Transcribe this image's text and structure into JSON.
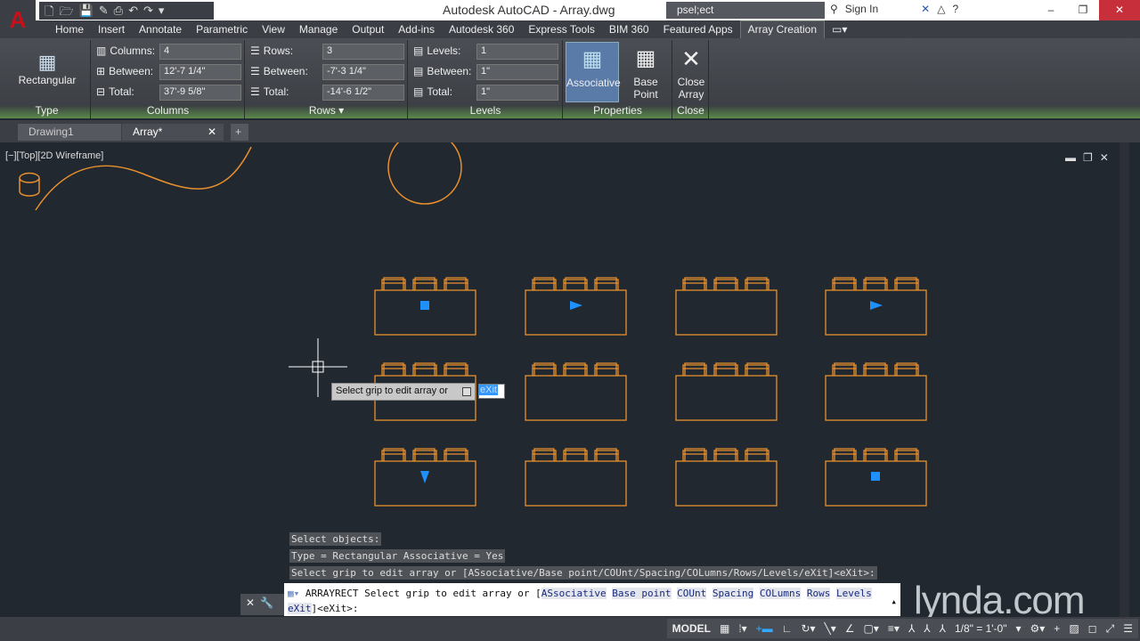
{
  "title": "Autodesk AutoCAD - Array.dwg",
  "search": "psel;ect",
  "signin": "Sign In",
  "menu": [
    "Home",
    "Insert",
    "Annotate",
    "Parametric",
    "View",
    "Manage",
    "Output",
    "Add-ins",
    "Autodesk 360",
    "Express Tools",
    "BIM 360",
    "Featured Apps",
    "Array Creation"
  ],
  "ribbon": {
    "type": {
      "button": "Rectangular",
      "title": "Type"
    },
    "columns": {
      "title": "Columns",
      "count_label": "Columns:",
      "count": "4",
      "between_label": "Between:",
      "between": "12'-7 1/4\"",
      "total_label": "Total:",
      "total": "37'-9 5/8\""
    },
    "rows": {
      "title": "Rows",
      "count_label": "Rows:",
      "count": "3",
      "between_label": "Between:",
      "between": "-7'-3 1/4\"",
      "total_label": "Total:",
      "total": "-14'-6 1/2\""
    },
    "levels": {
      "title": "Levels",
      "count_label": "Levels:",
      "count": "1",
      "between_label": "Between:",
      "between": "1\"",
      "total_label": "Total:",
      "total": "1\""
    },
    "properties": {
      "title": "Properties",
      "associative": "Associative",
      "base_point": "Base Point"
    },
    "close": {
      "title": "Close",
      "button_line1": "Close",
      "button_line2": "Array"
    }
  },
  "tabs": [
    "Drawing1",
    "Array*"
  ],
  "viewport_label": "[−][Top][2D Wireframe]",
  "array": {
    "rows": 3,
    "cols": 4,
    "grips": [
      [
        "square",
        "arrow-right",
        null,
        "arrow-right"
      ],
      [
        null,
        null,
        null,
        null
      ],
      [
        "arrow-down",
        null,
        null,
        "square"
      ]
    ]
  },
  "colors": {
    "geometry": "#e8902e",
    "grip": "#1e90ff",
    "background": "#212830"
  },
  "tooltip": "Select grip to edit array or",
  "dyn_input": "eXit",
  "history": [
    "Select objects:",
    "Type = Rectangular  Associative = Yes",
    "Select grip to edit array or [ASsociative/Base point/COUnt/Spacing/COLumns/Rows/Levels/eXit]<eXit>:"
  ],
  "command": {
    "name": "ARRAYRECT",
    "prompt": "Select grip to edit array or [",
    "options": [
      "ASsociative",
      "Base point",
      "COUnt",
      "Spacing",
      "COLumns",
      "Rows",
      "Levels",
      "eXit"
    ],
    "suffix": "]<eXit>:"
  },
  "status": {
    "model": "MODEL",
    "scale": "1/8\" = 1'-0\""
  },
  "watermark": "lynda.com"
}
